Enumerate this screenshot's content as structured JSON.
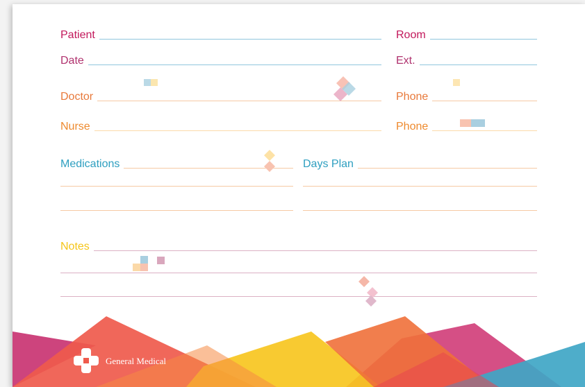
{
  "form": {
    "patient_label": "Patient",
    "room_label": "Room",
    "date_label": "Date",
    "ext_label": "Ext.",
    "doctor_label": "Doctor",
    "doctor_phone_label": "Phone",
    "nurse_label": "Nurse",
    "nurse_phone_label": "Phone",
    "medications_label": "Medications",
    "days_plan_label": "Days Plan",
    "notes_label": "Notes"
  },
  "brand": {
    "name": "General Medical"
  },
  "colors": {
    "patient": "#c2185b",
    "date": "#b0326e",
    "doctor": "#e8793a",
    "nurse": "#ee8a2e",
    "medications": "#2e9fc0",
    "notes": "#f5c518",
    "line_blue": "#8fc6dd",
    "line_orange": "#f6c9a4",
    "line_pink": "#dcb0c4"
  }
}
